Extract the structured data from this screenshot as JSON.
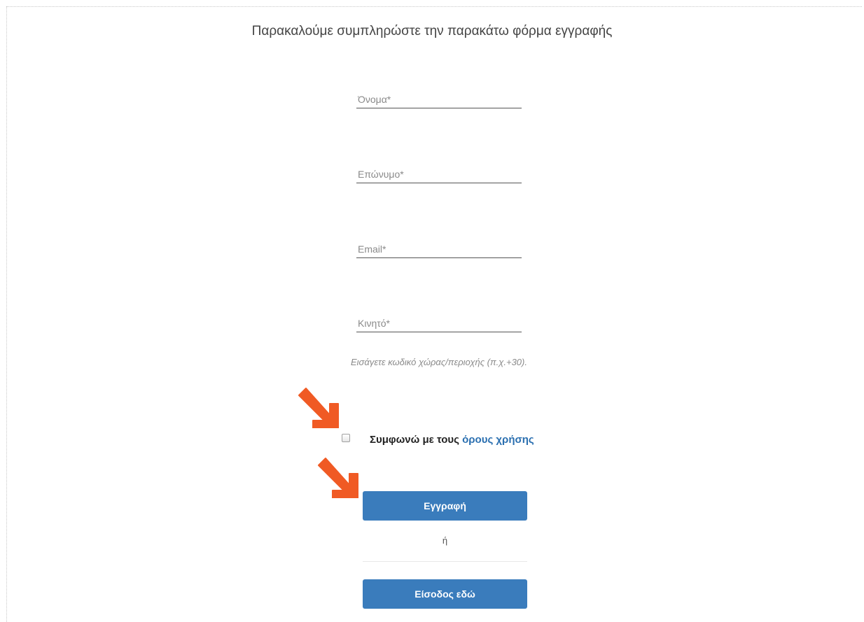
{
  "form": {
    "heading": "Παρακαλούμε συμπληρώστε την παρακάτω φόρμα εγγραφής",
    "first_name_placeholder": "Όνομα*",
    "last_name_placeholder": "Επώνυμο*",
    "email_placeholder": "Email*",
    "mobile_placeholder": "Κινητό*",
    "mobile_hint": "Εισάγετε κωδικό χώρας/περιοχής (π.χ.+30).",
    "terms_prefix": "Συμφωνώ με τους",
    "terms_link": "όρους χρήσης",
    "register_label": "Εγγραφή",
    "or_label": "ή",
    "login_label": "Είσοδος εδώ"
  },
  "colors": {
    "button": "#3a7cbc",
    "link": "#2a6fb0",
    "annotation_arrow": "#f05a24"
  },
  "icons": {
    "annotation": "arrow-down-right-icon"
  }
}
